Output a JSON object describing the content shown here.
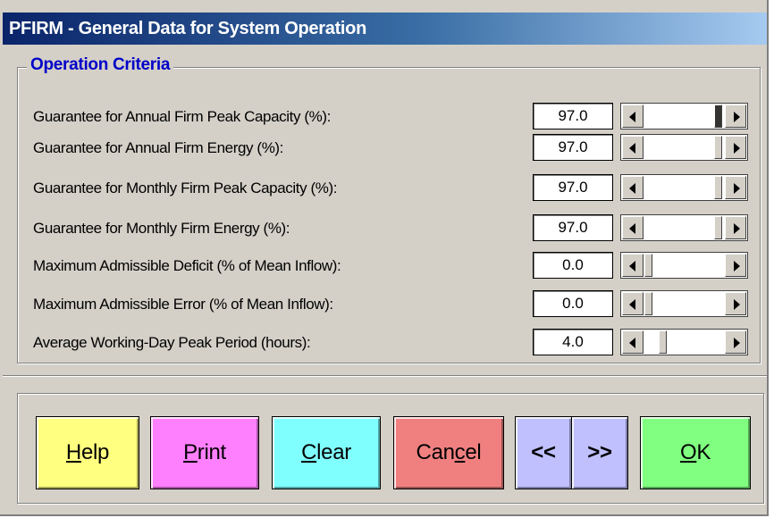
{
  "window": {
    "title": "PFIRM - General Data for System Operation"
  },
  "group": {
    "title": "Operation Criteria"
  },
  "rows": [
    {
      "label": "Guarantee for Annual Firm Peak Capacity (%):",
      "value": "97.0",
      "scroll_position": 0.97,
      "thumb_style": "dotted"
    },
    {
      "label": "Guarantee for Annual Firm Energy (%):",
      "value": "97.0",
      "scroll_position": 0.97,
      "thumb_style": "plain"
    },
    {
      "label": "Guarantee for Monthly Firm Peak Capacity (%):",
      "value": "97.0",
      "scroll_position": 0.97,
      "thumb_style": "plain"
    },
    {
      "label": "Guarantee for Monthly Firm Energy (%):",
      "value": "97.0",
      "scroll_position": 0.97,
      "thumb_style": "plain"
    },
    {
      "label": "Maximum Admissible Deficit (% of Mean Inflow):",
      "value": "0.0",
      "scroll_position": 0.0,
      "thumb_style": "plain"
    },
    {
      "label": "Maximum Admissible Error (% of Mean Inflow):",
      "value": "0.0",
      "scroll_position": 0.0,
      "thumb_style": "plain"
    },
    {
      "label": "Average Working-Day Peak Period (hours):",
      "value": "4.0",
      "scroll_position": 0.2,
      "thumb_style": "plain"
    }
  ],
  "buttons": {
    "help": {
      "pre": "",
      "ul": "H",
      "post": "elp",
      "color": "#ffff80"
    },
    "print": {
      "pre": "",
      "ul": "P",
      "post": "rint",
      "color": "#ff80ff"
    },
    "clear": {
      "pre": "",
      "ul": "C",
      "post": "lear",
      "color": "#80ffff"
    },
    "cancel": {
      "pre": "Can",
      "ul": "c",
      "post": "el",
      "color": "#f08080"
    },
    "prev": {
      "label": "<<",
      "color": "#c0c0ff"
    },
    "next": {
      "label": ">>",
      "color": "#c0c0ff"
    },
    "ok": {
      "pre": "",
      "ul": "O",
      "post": "K",
      "color": "#80ff80"
    }
  },
  "icons": {
    "scroll_left": "scroll-left-arrow-icon",
    "scroll_right": "scroll-right-arrow-icon"
  }
}
